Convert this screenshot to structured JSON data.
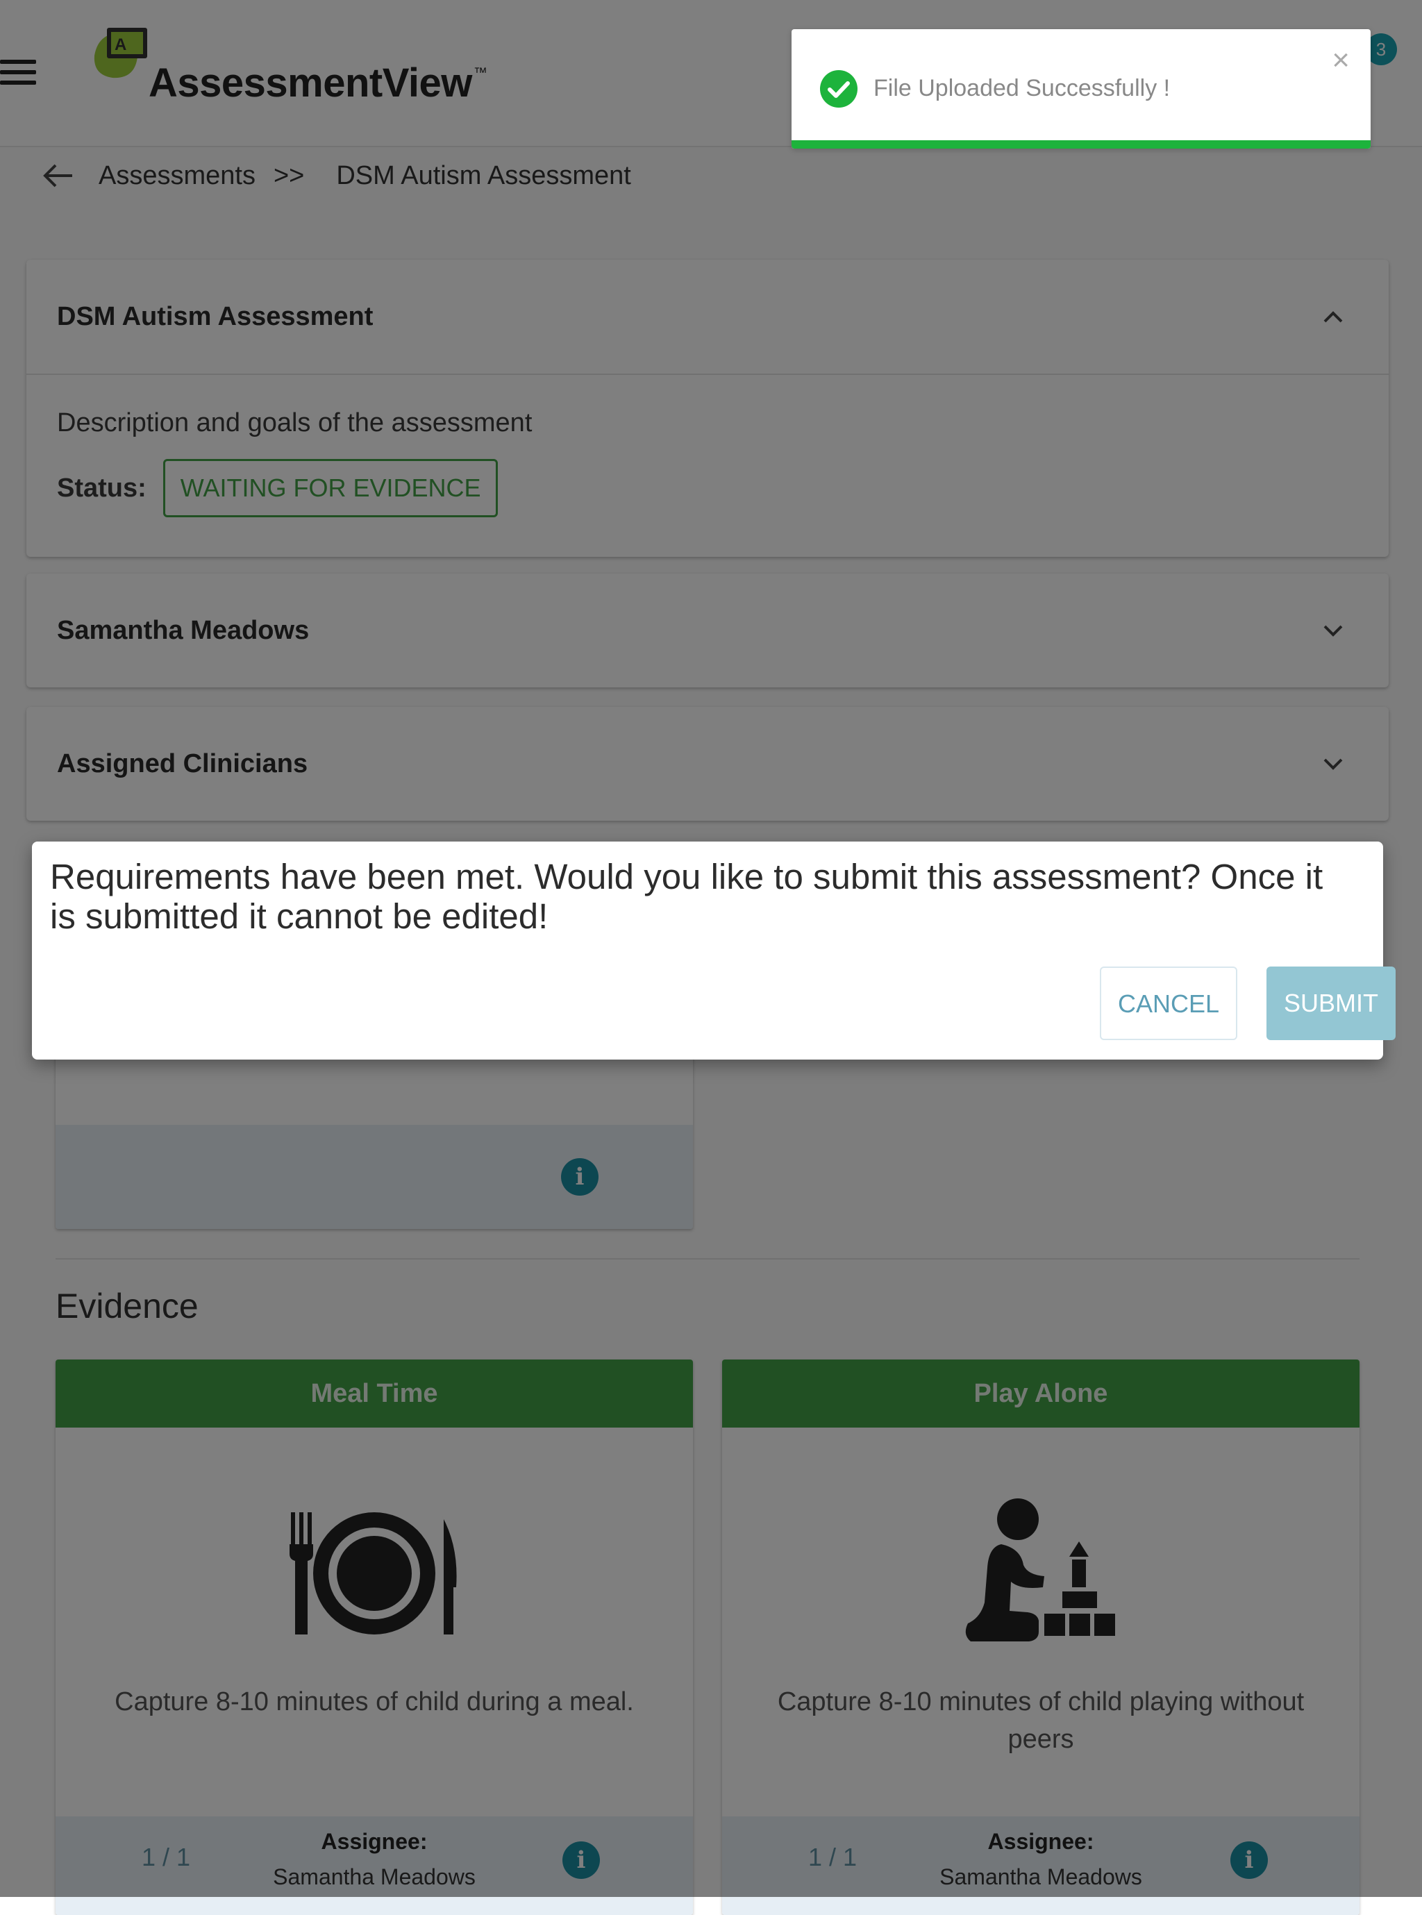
{
  "app": {
    "logo_text": "AssessmentView",
    "trademark": "™",
    "notification_count": "3"
  },
  "breadcrumb": {
    "parent": "Assessments",
    "separator": ">>",
    "current": "DSM Autism Assessment"
  },
  "assessment_panel": {
    "title": "DSM Autism Assessment",
    "description": "Description and goals of the assessment",
    "status_label": "Status:",
    "status_value": "WAITING FOR EVIDENCE"
  },
  "patient_panel": {
    "title": "Samantha Meadows"
  },
  "clinicians_panel": {
    "title": "Assigned Clinicians"
  },
  "evidence": {
    "title": "Evidence",
    "cards": [
      {
        "title": "Meal Time",
        "icon": "meal-icon",
        "description": "Capture 8-10 minutes of child during a meal.",
        "count": "1 / 1",
        "assignee_label": "Assignee:",
        "assignee": "Samantha Meadows"
      },
      {
        "title": "Play Alone",
        "icon": "child-playing-icon",
        "description": "Capture 8-10 minutes of child playing without peers",
        "count": "1 / 1",
        "assignee_label": "Assignee:",
        "assignee": "Samantha Meadows"
      }
    ]
  },
  "dialog": {
    "message": "Requirements have been met. Would you like to submit this assessment? Once it is submitted it cannot be edited!",
    "cancel_label": "CANCEL",
    "submit_label": "SUBMIT"
  },
  "toast": {
    "message": "File Uploaded Successfully !",
    "close": "×",
    "progress": 1.0
  },
  "colors": {
    "accent_green": "#43a047",
    "primary_teal": "#1a8ea3",
    "submit_button": "#93c6d3",
    "toast_bar": "#1db33c"
  }
}
